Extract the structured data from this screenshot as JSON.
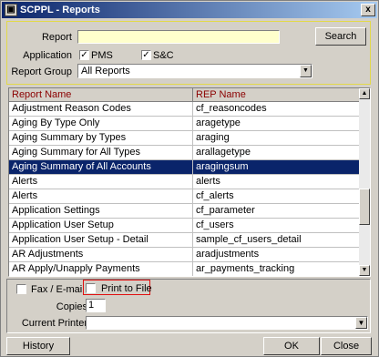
{
  "window": {
    "title": "SCPPL - Reports",
    "close_glyph": "x"
  },
  "filters": {
    "report_label": "Report",
    "report_value": "",
    "search_label": "Search",
    "application_label": "Application",
    "pms_label": "PMS",
    "pms_checked": true,
    "sc_label": "S&C",
    "sc_checked": true,
    "group_label": "Report Group",
    "group_value": "All Reports"
  },
  "grid": {
    "columns": [
      "Report Name",
      "REP Name"
    ],
    "selected_index": 5,
    "rows": [
      [
        "Adjustment Reason Codes",
        "cf_reasoncodes"
      ],
      [
        "Aging By Type Only",
        "aragetype"
      ],
      [
        "Aging Summary by Types",
        "araging"
      ],
      [
        "Aging Summary for All Types",
        "arallagetype"
      ],
      [
        "Aging Summary of All Accounts",
        "aragingsum"
      ],
      [
        "Alerts",
        "alerts"
      ],
      [
        "Alerts",
        "cf_alerts"
      ],
      [
        "Application Settings",
        "cf_parameter"
      ],
      [
        "Application User Setup",
        "cf_users"
      ],
      [
        "Application User Setup - Detail",
        "sample_cf_users_detail"
      ],
      [
        "AR Adjustments",
        "aradjustments"
      ],
      [
        "AR Apply/Unapply Payments",
        "ar_payments_tracking"
      ]
    ]
  },
  "output": {
    "fax_label": "Fax / E-mail",
    "fax_checked": false,
    "print_label": "Print to File",
    "print_checked": false,
    "copies_label": "Copies",
    "copies_value": "1",
    "printer_label": "Current Printer",
    "printer_value": ""
  },
  "footer": {
    "history_label": "History",
    "ok_label": "OK",
    "close_label": "Close"
  }
}
